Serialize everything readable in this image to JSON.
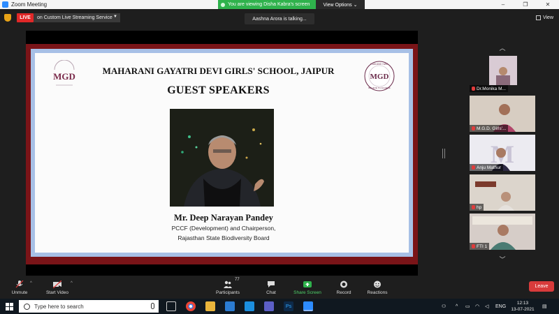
{
  "window": {
    "title": "Zoom Meeting",
    "controls": [
      "–",
      "❐",
      "✕"
    ]
  },
  "share_banner": {
    "viewing_text": "You are viewing Disha Kabra's screen",
    "view_options": "View Options ⌄"
  },
  "topbar": {
    "live_label": "LIVE",
    "live_service": "on Custom Live Streaming Service",
    "talking": "Aashna Arora is talking...",
    "view_label": "View"
  },
  "slide": {
    "school_name": "MAHARANI GAYATRI DEVI GIRLS' SCHOOL, JAIPUR",
    "heading": "GUEST SPEAKERS",
    "speaker_name": "Mr. Deep Narayan Pandey",
    "speaker_title_1": "PCCF (Development) and Chairperson,",
    "speaker_title_2": "Rajasthan State Biodiversity Board",
    "logo_left_text": "MGD",
    "logo_right_text": "MGD",
    "logo_right_top": "I CAN AND I WILL",
    "logo_right_bottom": "BELIEVE TO ACHIEVE"
  },
  "gallery": [
    {
      "name": "Dr.Monika M..."
    },
    {
      "name": "M.G.D. Girls'..."
    },
    {
      "name": "Anju Mathur"
    },
    {
      "name": "hp"
    },
    {
      "name": "FTI 1"
    }
  ],
  "toolbar": {
    "unmute": "Unmute",
    "start_video": "Start Video",
    "participants": "Participants",
    "participants_count": "77",
    "chat": "Chat",
    "share_screen": "Share Screen",
    "record": "Record",
    "reactions": "Reactions",
    "leave": "Leave"
  },
  "taskbar": {
    "search_placeholder": "Type here to search",
    "language": "ENG",
    "time": "12:13",
    "date": "13-07-2021"
  },
  "colors": {
    "live_red": "#e02828",
    "share_green": "#2fb24c",
    "slide_maroon": "#7a1418",
    "slide_blue": "#a7c0e6",
    "leave_red": "#d83b3b"
  }
}
